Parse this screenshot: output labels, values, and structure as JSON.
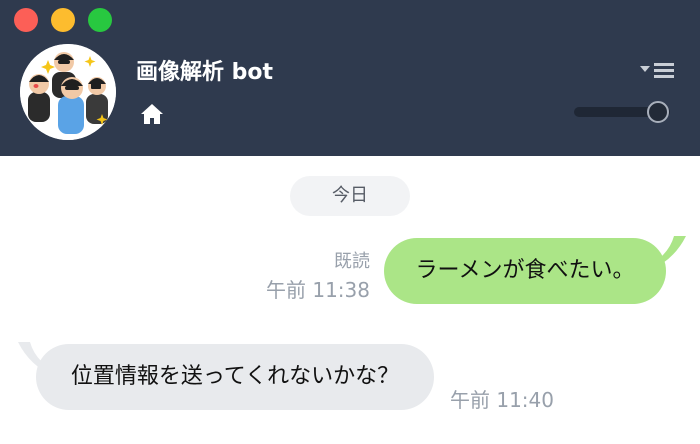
{
  "window": {
    "controls": [
      "close-button",
      "minimize-button",
      "maximize-button"
    ]
  },
  "header": {
    "title": "画像解析 bot",
    "home_icon": "home-icon",
    "menu_icon": "menu-dropdown-icon",
    "volume_slider_value": 0.9
  },
  "chat": {
    "date_label": "今日",
    "messages": [
      {
        "direction": "outgoing",
        "text": "ラーメンが食べたい。",
        "read_label": "既読",
        "time": "午前 11:38"
      },
      {
        "direction": "incoming",
        "text": "位置情報を送ってくれないかな？",
        "time": "午前 11:40"
      }
    ]
  },
  "colors": {
    "header_background": "#2f3a4e",
    "outgoing_bubble": "#abe587",
    "incoming_bubble": "#e8eaed",
    "close_button": "#fc5f57",
    "minimize_button": "#fdbc2e",
    "maximize_button": "#28c840"
  }
}
